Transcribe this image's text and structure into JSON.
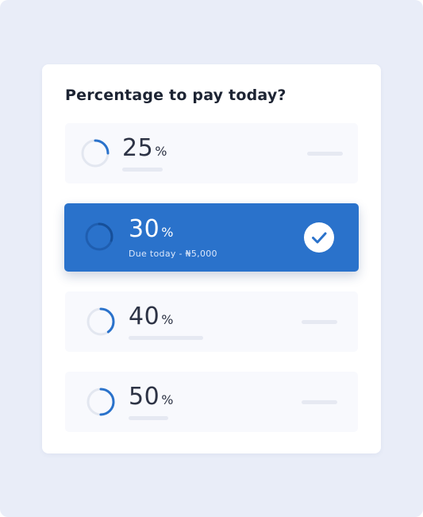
{
  "question": "Percentage to pay today?",
  "options": [
    {
      "value": "25",
      "unit": "%",
      "selected": false,
      "progress": 0.25
    },
    {
      "value": "30",
      "unit": "%",
      "selected": true,
      "progress": 0.3,
      "subtitle": "Due today - ₦5,000"
    },
    {
      "value": "40",
      "unit": "%",
      "selected": false,
      "progress": 0.4
    },
    {
      "value": "50",
      "unit": "%",
      "selected": false,
      "progress": 0.5
    }
  ],
  "colors": {
    "accent": "#2a72cb",
    "ring_track": "#e3e7f0",
    "ring_fill": "#2a72cb",
    "ring_selected_track": "#1f5eb0",
    "ring_selected_fill": "#164f99"
  },
  "icons": {
    "selected": "check-circle-icon"
  }
}
